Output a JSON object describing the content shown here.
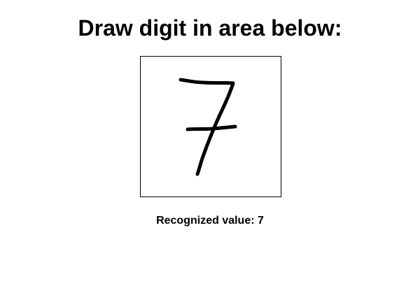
{
  "heading": "Draw digit in area below:",
  "drawing_area": {
    "stroke_color": "#000000",
    "drawn_digit": "7"
  },
  "result": {
    "label": "Recognized value:",
    "value": "7"
  }
}
